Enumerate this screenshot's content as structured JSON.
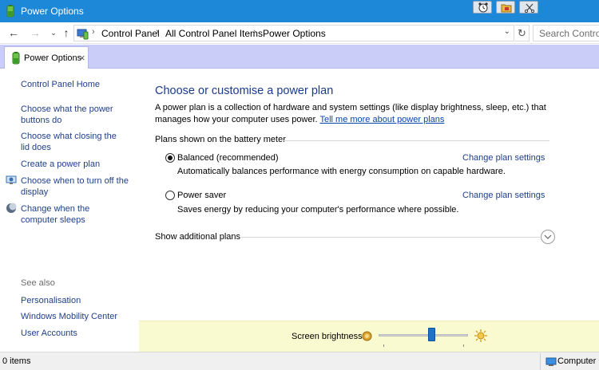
{
  "window": {
    "title": "Power Options",
    "icon": "battery-plug-icon"
  },
  "address": {
    "crumbs": [
      "Control Panel",
      "All Control Panel Items",
      "Power Options"
    ],
    "search_placeholder": "Search Control P"
  },
  "tab": {
    "label": "Power Options"
  },
  "sidebar": {
    "home": "Control Panel Home",
    "links": [
      "Choose what the power buttons do",
      "Choose what closing the lid does",
      "Create a power plan",
      "Choose when to turn off the display",
      "Change when the computer sleeps"
    ],
    "see_also_label": "See also",
    "see_also": [
      "Personalisation",
      "Windows Mobility Center",
      "User Accounts"
    ]
  },
  "main": {
    "title": "Choose or customise a power plan",
    "description": "A power plan is a collection of hardware and system settings (like display brightness, sleep, etc.) that manages how your computer uses power.",
    "learn_more": "Tell me more about power plans",
    "group_label": "Plans shown on the battery meter",
    "plans": [
      {
        "name": "Balanced (recommended)",
        "description": "Automatically balances performance with energy consumption on capable hardware.",
        "link": "Change plan settings",
        "selected": true
      },
      {
        "name": "Power saver",
        "description": "Saves energy by reducing your computer's performance where possible.",
        "link": "Change plan settings",
        "selected": false
      }
    ],
    "additional_label": "Show additional plans"
  },
  "brightness": {
    "label": "Screen brightness:",
    "level_percent": 60
  },
  "status": {
    "items": "0 items",
    "location": "Computer"
  },
  "colors": {
    "titlebar": "#1e88d8",
    "tabstrip": "#c9cdf7",
    "link": "#1f3f8a",
    "heading": "#1a3a8c",
    "brightness_bar": "#fafad0"
  }
}
